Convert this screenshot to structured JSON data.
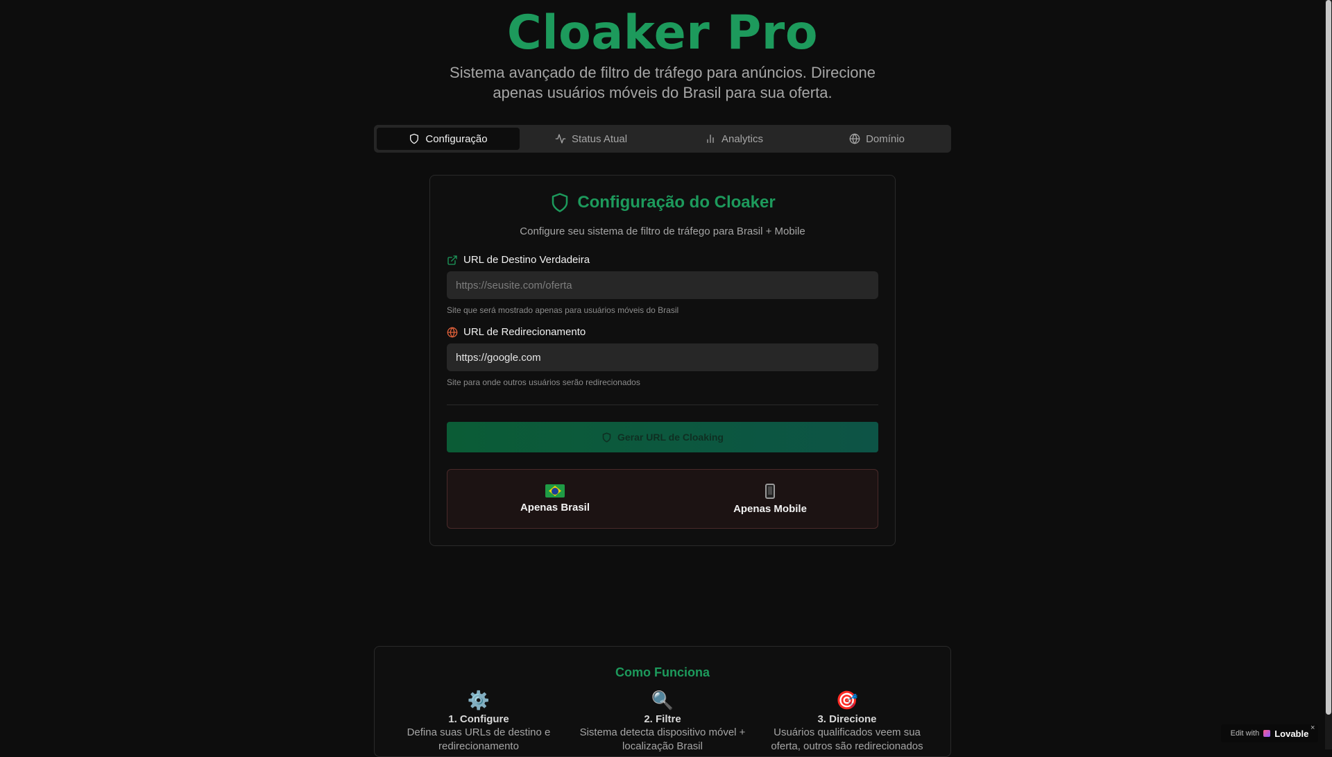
{
  "header": {
    "title": "Cloaker Pro",
    "subtitle": "Sistema avançado de filtro de tráfego para anúncios. Direcione apenas usuários móveis do Brasil para sua oferta."
  },
  "tabs": [
    {
      "label": "Configuração",
      "icon": "shield-icon",
      "active": true
    },
    {
      "label": "Status Atual",
      "icon": "activity-icon",
      "active": false
    },
    {
      "label": "Analytics",
      "icon": "bar-chart-icon",
      "active": false
    },
    {
      "label": "Domínio",
      "icon": "globe-icon",
      "active": false
    }
  ],
  "config": {
    "title": "Configuração do Cloaker",
    "description": "Configure seu sistema de filtro de tráfego para Brasil + Mobile",
    "dest_label": "URL de Destino Verdadeira",
    "dest_placeholder": "https://seusite.com/oferta",
    "dest_value": "",
    "dest_hint": "Site que será mostrado apenas para usuários móveis do Brasil",
    "redirect_label": "URL de Redirecionamento",
    "redirect_value": "https://google.com",
    "redirect_hint": "Site para onde outros usuários serão redirecionados",
    "generate_label": "Gerar URL de Cloaking",
    "filters": [
      {
        "label": "Apenas Brasil",
        "icon": "brazil-flag-icon"
      },
      {
        "label": "Apenas Mobile",
        "icon": "mobile-phone-icon"
      }
    ]
  },
  "how": {
    "title": "Como Funciona",
    "steps": [
      {
        "icon": "⚙️",
        "title": "1. Configure",
        "desc": "Defina suas URLs de destino e redirecionamento"
      },
      {
        "icon": "🔍",
        "title": "2. Filtre",
        "desc": "Sistema detecta dispositivo móvel + localização Brasil"
      },
      {
        "icon": "🎯",
        "title": "3. Direcione",
        "desc": "Usuários qualificados veem sua oferta, outros são redirecionados"
      }
    ]
  },
  "badge": {
    "prefix": "Edit with",
    "brand": "Lovable",
    "close": "×"
  },
  "colors": {
    "accent": "#1d9a5c",
    "background": "#0d0d0d",
    "card_border": "#2a2a2a",
    "filter_bg": "#1c1313"
  }
}
